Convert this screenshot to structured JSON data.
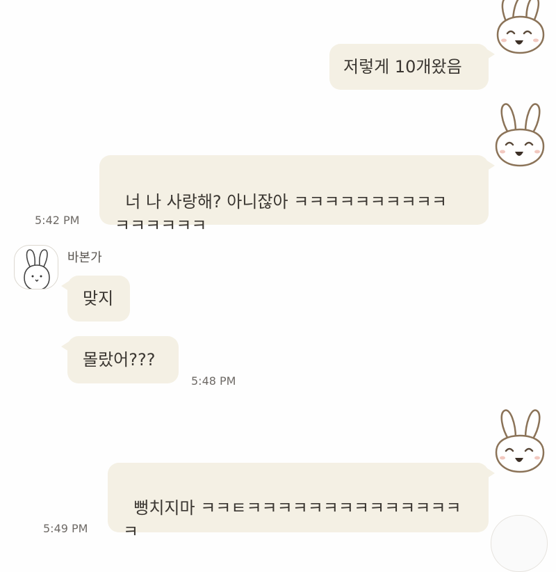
{
  "messages": {
    "m1": {
      "text": "저렇게 10개왔음"
    },
    "m2": {
      "text": "너 나 사랑해? 아니잖아 ㅋㅋㅋㅋㅋㅋㅋㅋㅋㅋ\nㅋㅋㅋㅋㅋㅋ",
      "time": "5:42 PM"
    },
    "m3": {
      "sender": "바본가",
      "text": "맞지"
    },
    "m4": {
      "text": "몰랐어???",
      "time": "5:48 PM"
    },
    "m5": {
      "text": "뻥치지마 ㅋㅋㅌㅋㅋㅋㅋㅋㅋㅋㅋㅋㅋㅋㅋㅋㅋ\nㅋ",
      "time": "5:49 PM"
    }
  },
  "icons": {
    "sticker": "bunny-face-sticker",
    "avatar": "bunny-avatar-icon"
  },
  "colors": {
    "bubble": "#f4f0e4",
    "sticker_line": "#8b7358"
  }
}
